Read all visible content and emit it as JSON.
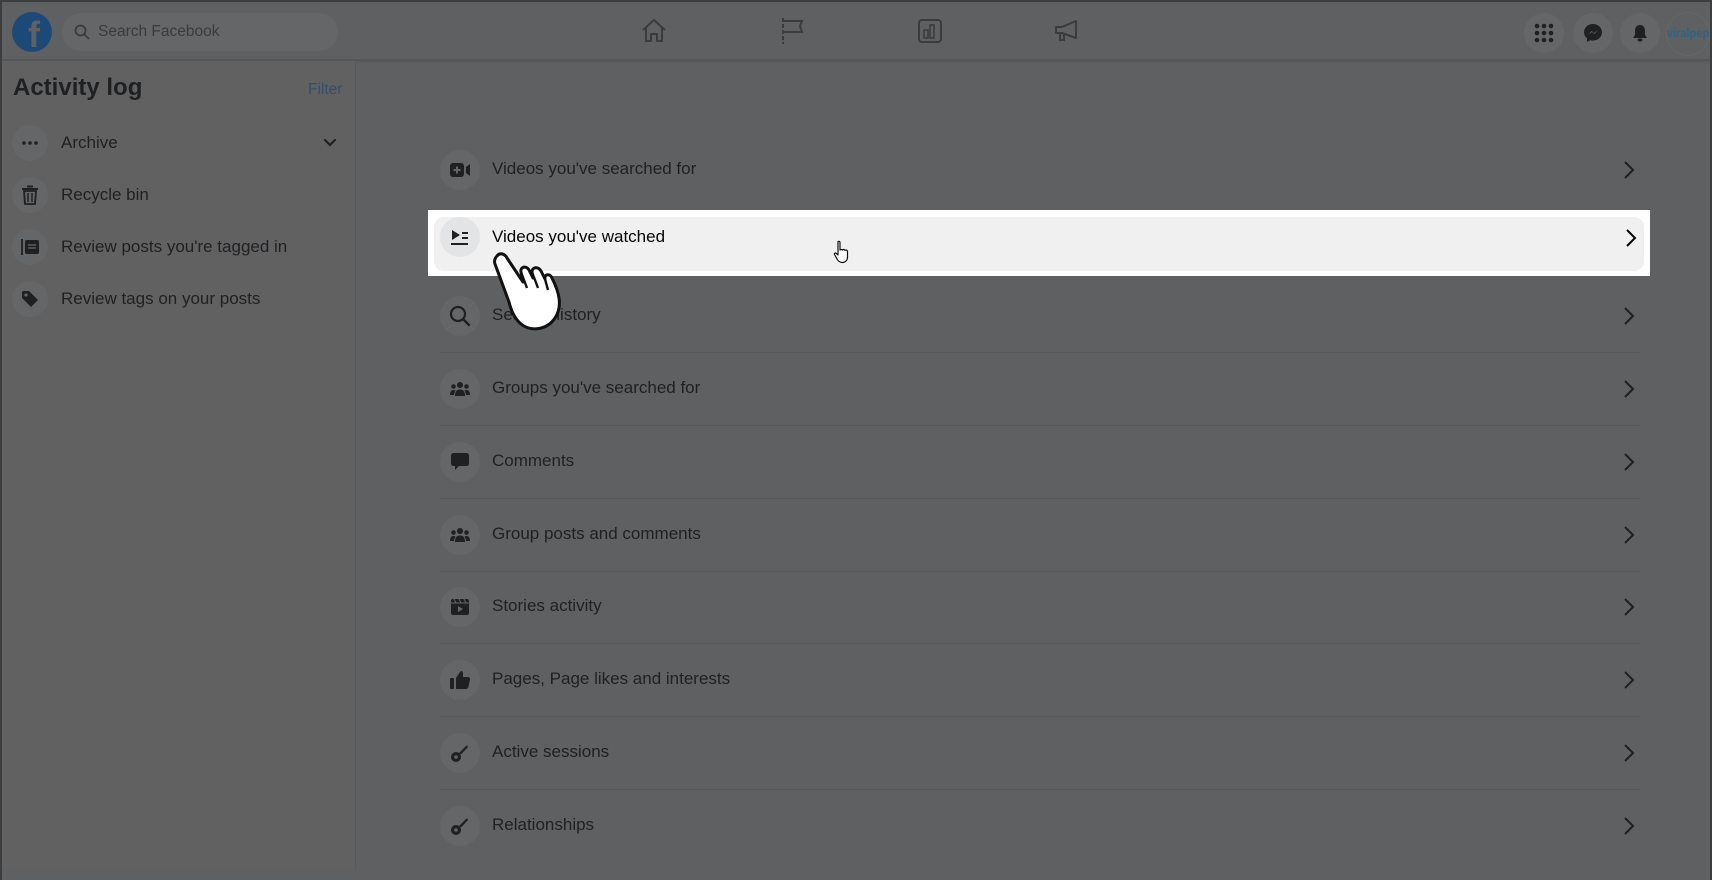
{
  "topbar": {
    "logo": "facebook-logo",
    "logo_glyph": "f",
    "search_placeholder": "Search Facebook",
    "nav_icons": [
      "home-icon",
      "flag-icon",
      "insights-icon",
      "megaphone-icon"
    ],
    "right_icons": [
      "menu-grid-icon",
      "messenger-icon",
      "bell-icon"
    ],
    "avatar_text": "viralpep"
  },
  "sidebar": {
    "title": "Activity log",
    "filter_label": "Filter",
    "items": [
      {
        "label": "Archive",
        "icon": "more-dots-icon",
        "expandable": true
      },
      {
        "label": "Recycle bin",
        "icon": "trash-icon"
      },
      {
        "label": "Review posts you're tagged in",
        "icon": "tagged-posts-icon"
      },
      {
        "label": "Review tags on your posts",
        "icon": "tag-icon"
      }
    ]
  },
  "main": {
    "items": [
      {
        "label": "Videos you've searched for",
        "icon": "video-plus-icon"
      },
      {
        "label": "Videos you've watched",
        "icon": "play-list-icon",
        "highlighted": true
      },
      {
        "label": "Search history",
        "icon": "search-icon"
      },
      {
        "label": "Groups you've searched for",
        "icon": "groups-icon"
      },
      {
        "label": "Comments",
        "icon": "comment-icon"
      },
      {
        "label": "Group posts and comments",
        "icon": "groups-icon"
      },
      {
        "label": "Stories activity",
        "icon": "stories-icon"
      },
      {
        "label": "Pages, Page likes and interests",
        "icon": "thumbs-up-icon"
      },
      {
        "label": "Active sessions",
        "icon": "key-icon"
      },
      {
        "label": "Relationships",
        "icon": "key-icon"
      }
    ]
  },
  "colors": {
    "overlay_bg": "#5f6061",
    "highlight_bg": "#f0f0f0",
    "highlight_frame": "#ffffff",
    "filter_link": "#344d6e",
    "avatar_text": "#2f6386"
  }
}
